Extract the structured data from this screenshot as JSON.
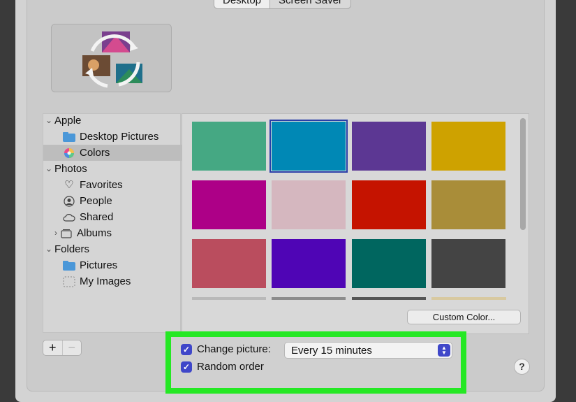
{
  "tabs": [
    {
      "label": "Desktop",
      "selected": true
    },
    {
      "label": "Screen Saver",
      "selected": false
    }
  ],
  "sidebar": {
    "items": [
      {
        "label": "Apple",
        "icon": "chevron-down-icon",
        "type": "group"
      },
      {
        "label": "Desktop Pictures",
        "icon": "folder-icon"
      },
      {
        "label": "Colors",
        "icon": "color-wheel-icon",
        "selected": true
      },
      {
        "label": "Photos",
        "icon": "chevron-down-icon",
        "type": "group"
      },
      {
        "label": "Favorites",
        "icon": "heart-icon"
      },
      {
        "label": "People",
        "icon": "person-icon"
      },
      {
        "label": "Shared",
        "icon": "cloud-icon"
      },
      {
        "label": "Albums",
        "icon": "album-icon"
      },
      {
        "label": "Folders",
        "icon": "chevron-down-icon",
        "type": "group"
      },
      {
        "label": "Pictures",
        "icon": "folder-icon"
      },
      {
        "label": "My Images",
        "icon": "dotted-folder-icon"
      }
    ]
  },
  "swatches": [
    {
      "color": "#45a883"
    },
    {
      "color": "#0088b5",
      "selected": true
    },
    {
      "color": "#5c3793"
    },
    {
      "color": "#cea200"
    },
    {
      "color": "#ad0087"
    },
    {
      "color": "#d5b7bf"
    },
    {
      "color": "#c51300"
    },
    {
      "color": "#a98d39"
    },
    {
      "color": "#ba4d5e"
    },
    {
      "color": "#4f05b5"
    },
    {
      "color": "#00665f"
    },
    {
      "color": "#444444"
    }
  ],
  "custom_color_label": "Custom Color...",
  "options": {
    "change_picture_label": "Change picture:",
    "change_picture_checked": true,
    "interval_value": "Every 15 minutes",
    "random_order_label": "Random order",
    "random_order_checked": true
  },
  "help_label": "?",
  "colors": {
    "highlight": "#25e824",
    "accent": "#3f47c9"
  }
}
